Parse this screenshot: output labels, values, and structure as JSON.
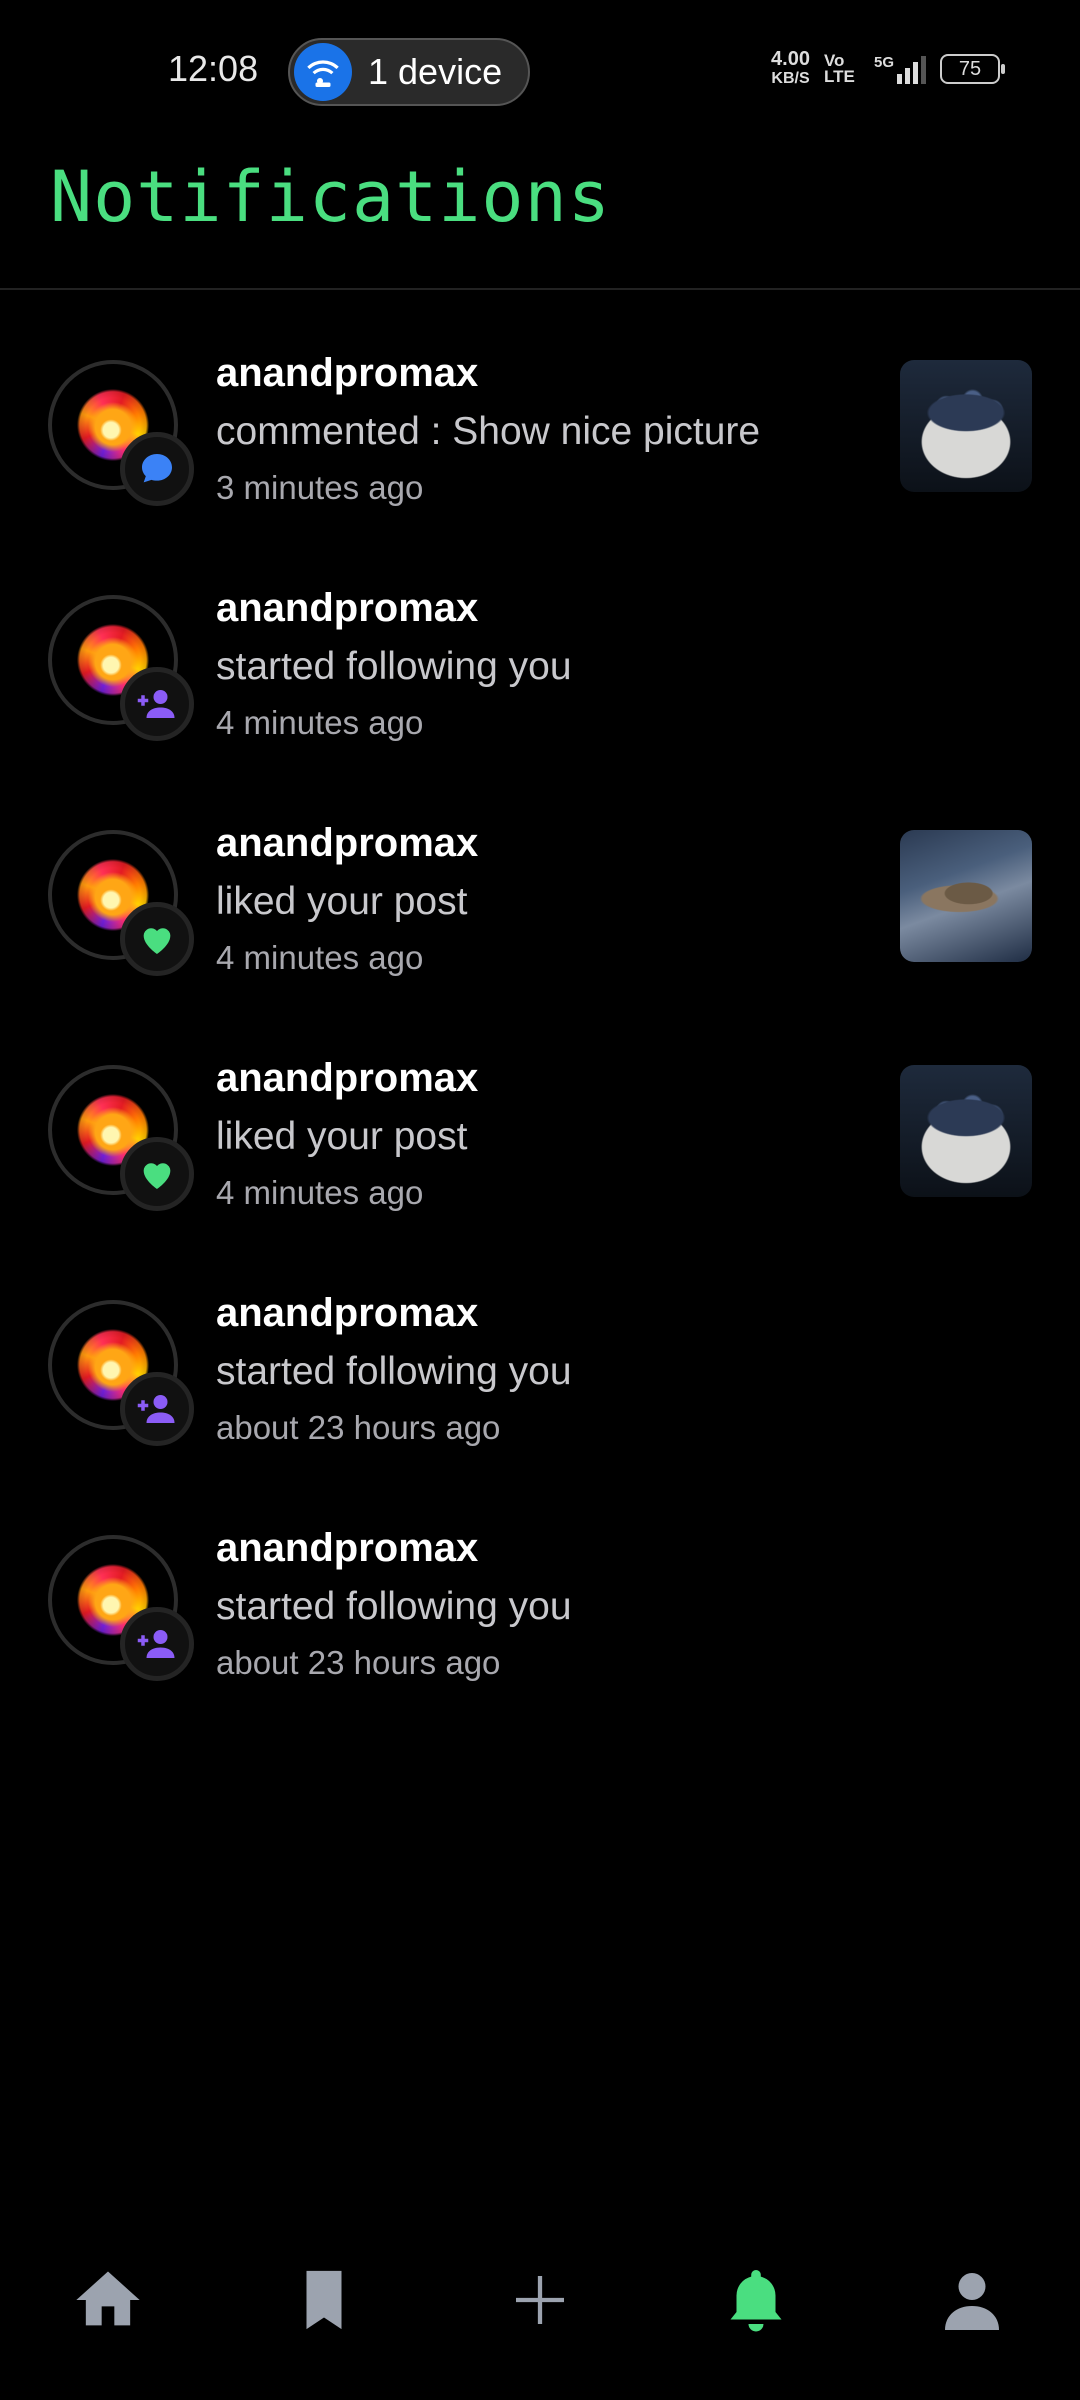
{
  "status_bar": {
    "time": "12:08",
    "hotspot_label": "1 device",
    "net_speed_value": "4.00",
    "net_speed_unit": "KB/S",
    "volte": "Vo LTE",
    "network_type": "5G",
    "battery": "75"
  },
  "header": {
    "title": "Notifications"
  },
  "colors": {
    "accent_green": "#4ade80",
    "comment_blue": "#3b82f6",
    "follow_purple": "#8b5cf6",
    "like_green": "#4ade80"
  },
  "notifications": [
    {
      "username": "anandpromax",
      "message": "commented : Show nice picture",
      "time": "3 minutes ago",
      "badge_icon": "comment-icon",
      "thumbnail": "blueberry-bowl"
    },
    {
      "username": "anandpromax",
      "message": "started following you",
      "time": "4 minutes ago",
      "badge_icon": "follow-icon"
    },
    {
      "username": "anandpromax",
      "message": "liked your post",
      "time": "4 minutes ago",
      "badge_icon": "heart-icon",
      "thumbnail": "pelican-flying"
    },
    {
      "username": "anandpromax",
      "message": "liked your post",
      "time": "4 minutes ago",
      "badge_icon": "heart-icon",
      "thumbnail": "blueberry-bowl"
    },
    {
      "username": "anandpromax",
      "message": "started following you",
      "time": "about 23 hours ago",
      "badge_icon": "follow-icon"
    },
    {
      "username": "anandpromax",
      "message": "started following you",
      "time": "about 23 hours ago",
      "badge_icon": "follow-icon"
    }
  ],
  "bottom_nav": {
    "items": [
      {
        "icon": "home-icon",
        "active": false
      },
      {
        "icon": "bookmark-icon",
        "active": false
      },
      {
        "icon": "plus-icon",
        "active": false
      },
      {
        "icon": "bell-icon",
        "active": true
      },
      {
        "icon": "profile-icon",
        "active": false
      }
    ]
  }
}
